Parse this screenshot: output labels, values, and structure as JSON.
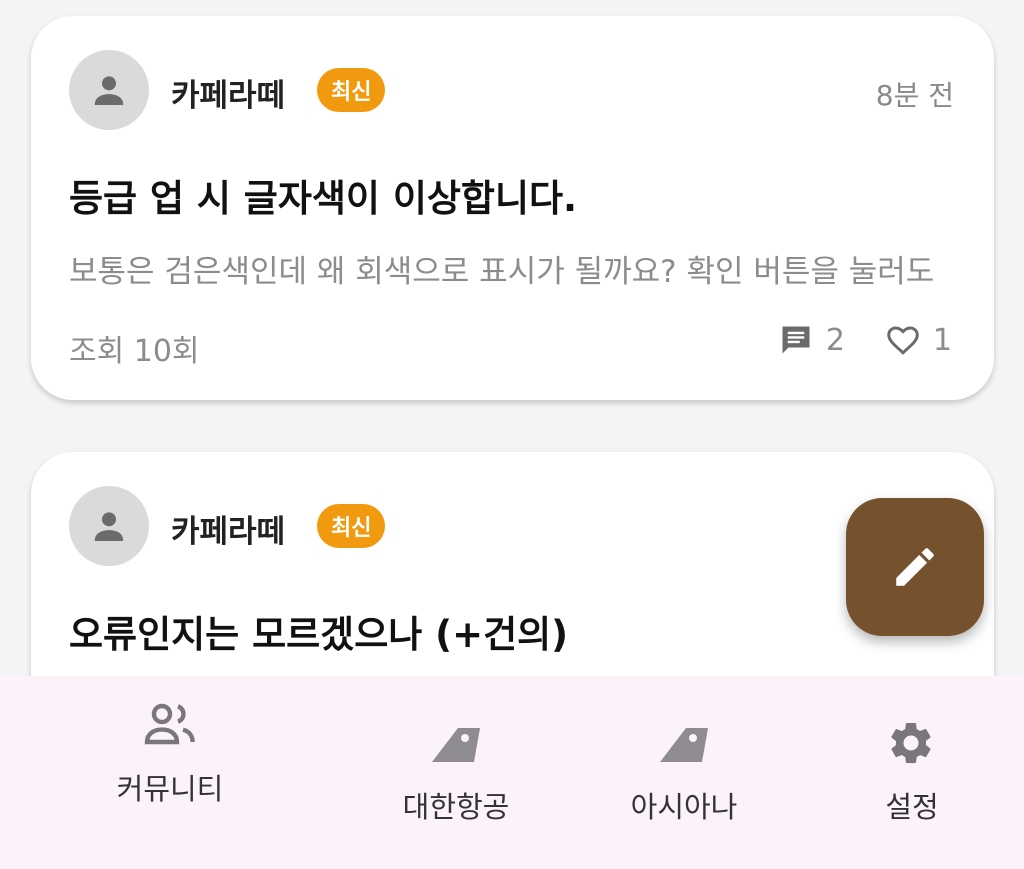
{
  "posts": [
    {
      "author": "카페라떼",
      "badge": "최신",
      "time": "8분 전",
      "title": "등급 업 시 글자색이 이상합니다.",
      "preview": "보통은 검은색인데 왜 회색으로 표시가 될까요? 확인 버튼을 눌러도",
      "views": "조회 10회",
      "comments": "2",
      "likes": "1"
    },
    {
      "author": "카페라떼",
      "badge": "최신",
      "title": "오류인지는 모르겠으나 (+건의)"
    }
  ],
  "fab": {
    "icon": "pencil-icon"
  },
  "bottom_nav": {
    "items": [
      {
        "label": "커뮤니티",
        "icon": "community-icon"
      },
      {
        "label": "대한항공",
        "icon": "airline-tail-icon"
      },
      {
        "label": "아시아나",
        "icon": "airline-tail-icon"
      },
      {
        "label": "설정",
        "icon": "gear-icon"
      }
    ]
  },
  "colors": {
    "badge": "#f29a0f",
    "fab": "#76512e",
    "nav_background": "#fcf2f9",
    "icon_gray": "#7a777c"
  }
}
